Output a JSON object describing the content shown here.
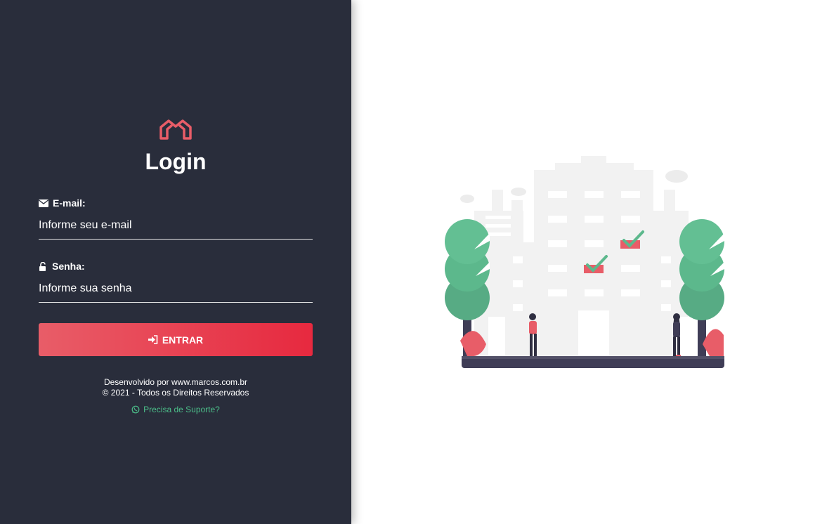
{
  "login": {
    "title": "Login",
    "email_label": "E-mail:",
    "email_placeholder": "Informe seu e-mail",
    "password_label": "Senha:",
    "password_placeholder": "Informe sua senha",
    "submit_label": "ENTRAR"
  },
  "footer": {
    "developed_by": "Desenvolvido por www.marcos.com.br",
    "copyright": "© 2021 - Todos os Direitos Reservados",
    "support_label": "Precisa de Suporte?"
  },
  "icons": {
    "logo": "house-logo-icon",
    "email": "envelope-icon",
    "password": "unlock-icon",
    "submit": "sign-in-icon",
    "support": "whatsapp-icon"
  },
  "colors": {
    "panel_bg": "#292d3b",
    "accent": "#e7293f",
    "accent_light": "#e85d68",
    "support": "#4cbf8a",
    "tree": "#5cb88c",
    "ground": "#3f3d56"
  }
}
